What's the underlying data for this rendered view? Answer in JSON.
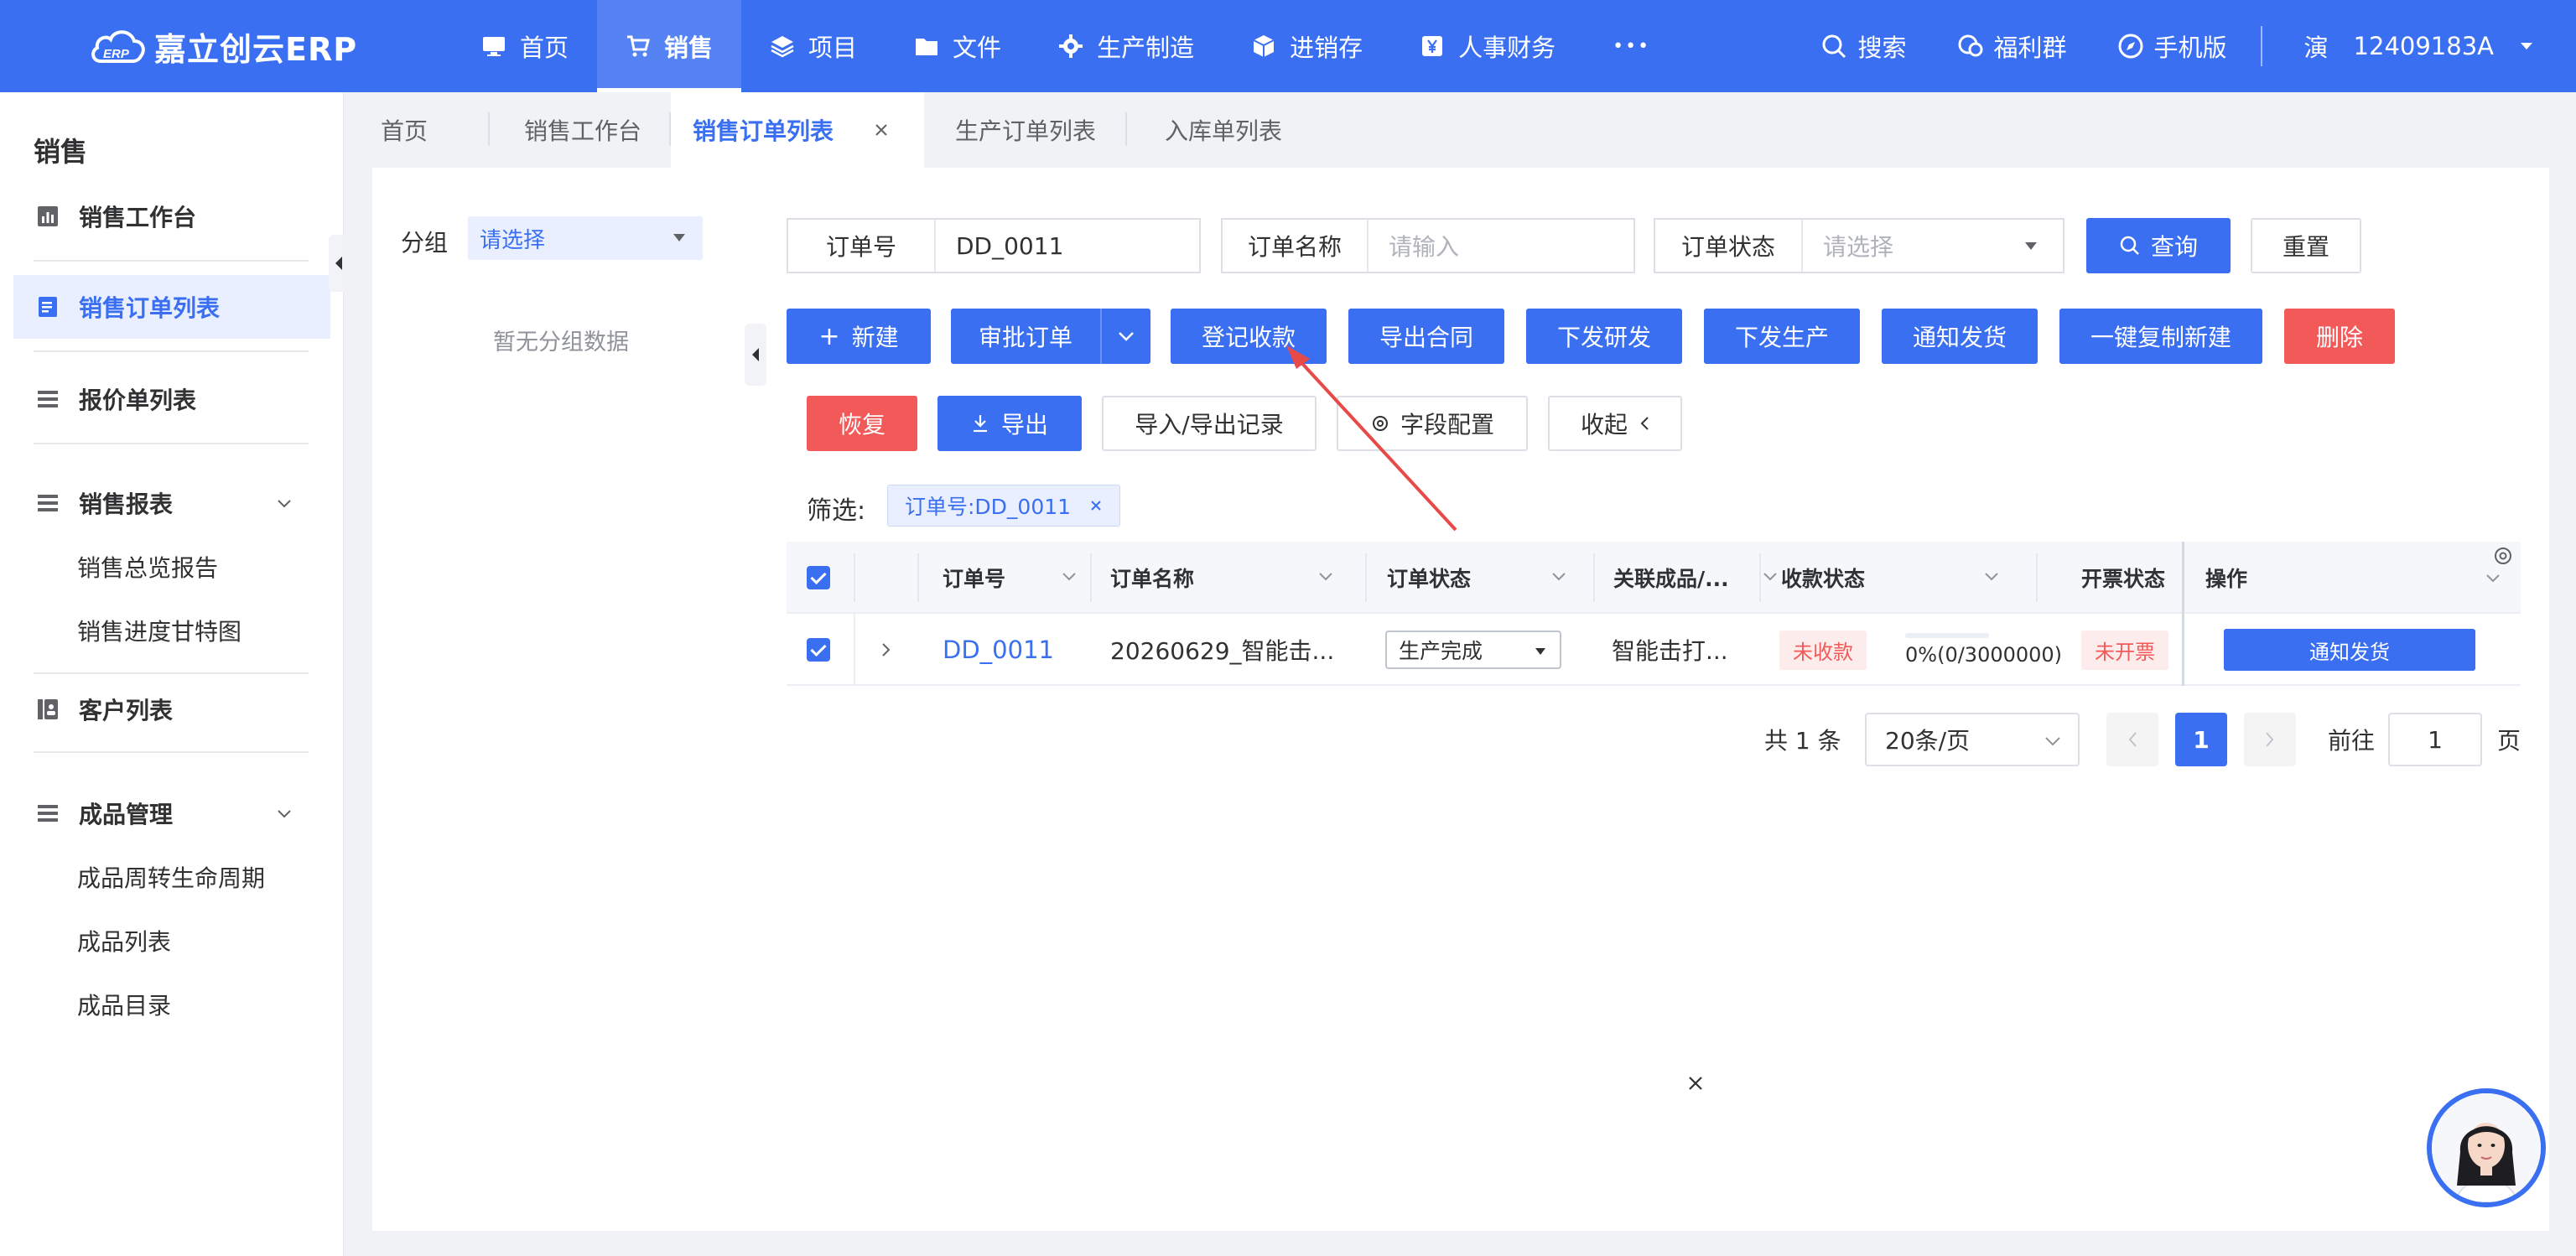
{
  "topbar": {
    "brand": "嘉立创云ERP",
    "brand_badge": "ERP",
    "nav": [
      {
        "label": "首页",
        "icon": "monitor-icon"
      },
      {
        "label": "销售",
        "icon": "cart-icon",
        "active": true
      },
      {
        "label": "项目",
        "icon": "layers-icon"
      },
      {
        "label": "文件",
        "icon": "folder-icon"
      },
      {
        "label": "生产制造",
        "icon": "gear-icon"
      },
      {
        "label": "进销存",
        "icon": "box-icon"
      },
      {
        "label": "人事财务",
        "icon": "yen-icon"
      }
    ],
    "more": "•••",
    "tools": [
      {
        "label": "搜索",
        "icon": "search-icon"
      },
      {
        "label": "福利群",
        "icon": "chat-icon"
      },
      {
        "label": "手机版",
        "icon": "compass-icon"
      }
    ],
    "user_short": "演",
    "user_id": "12409183A"
  },
  "sidebar": {
    "title": "销售",
    "items": [
      {
        "label": "销售工作台",
        "icon": "chart-icon"
      },
      {
        "label": "销售订单列表",
        "icon": "document-icon",
        "active": true
      },
      {
        "label": "报价单列表",
        "icon": "list-icon"
      },
      {
        "label": "销售报表",
        "icon": "list-icon",
        "expandable": true
      },
      {
        "label": "客户列表",
        "icon": "contacts-icon"
      },
      {
        "label": "成品管理",
        "icon": "list-icon",
        "expandable": true
      }
    ],
    "report_subs": [
      "销售总览报告",
      "销售进度甘特图"
    ],
    "product_subs": [
      "成品周转生命周期",
      "成品列表",
      "成品目录"
    ]
  },
  "tabs": [
    {
      "label": "首页"
    },
    {
      "label": "销售工作台"
    },
    {
      "label": "销售订单列表",
      "active": true
    },
    {
      "label": "生产订单列表"
    },
    {
      "label": "入库单列表"
    }
  ],
  "group": {
    "label": "分组",
    "select_placeholder": "请选择",
    "empty": "暂无分组数据"
  },
  "search": {
    "order_no_label": "订单号",
    "order_no_value": "DD_0011",
    "order_name_label": "订单名称",
    "order_name_placeholder": "请输入",
    "order_status_label": "订单状态",
    "order_status_placeholder": "请选择",
    "query": "查询",
    "reset": "重置"
  },
  "toolbar": {
    "new": "新建",
    "approve": "审批订单",
    "register_payment": "登记收款",
    "export_contract": "导出合同",
    "send_rd": "下发研发",
    "send_production": "下发生产",
    "notify_ship": "通知发货",
    "copy_new": "一键复制新建",
    "delete": "删除",
    "restore": "恢复",
    "export": "导出",
    "import_export_log": "导入/导出记录",
    "field_config": "字段配置",
    "collapse": "收起"
  },
  "filter": {
    "label": "筛选:",
    "tag": "订单号:DD_0011"
  },
  "table": {
    "columns": [
      "订单号",
      "订单名称",
      "订单状态",
      "关联成品/...",
      "收款状态",
      "开票状态",
      "操作"
    ],
    "rows": [
      {
        "order_no": "DD_0011",
        "order_name": "20260629_智能击...",
        "order_status": "生产完成",
        "product": "智能击打...",
        "payment_status": "未收款",
        "payment_progress_text": "0%(0/3000000)",
        "payment_progress": 0,
        "invoice_status": "未开票",
        "action": "通知发货"
      }
    ]
  },
  "pager": {
    "total": "共 1 条",
    "page_size": "20条/页",
    "current_page": "1",
    "goto_label": "前往",
    "goto_value": "1",
    "page_unit": "页"
  },
  "colors": {
    "primary": "#3A6FF2",
    "danger": "#F25A5A",
    "danger_tag_bg": "#FDECEC"
  }
}
